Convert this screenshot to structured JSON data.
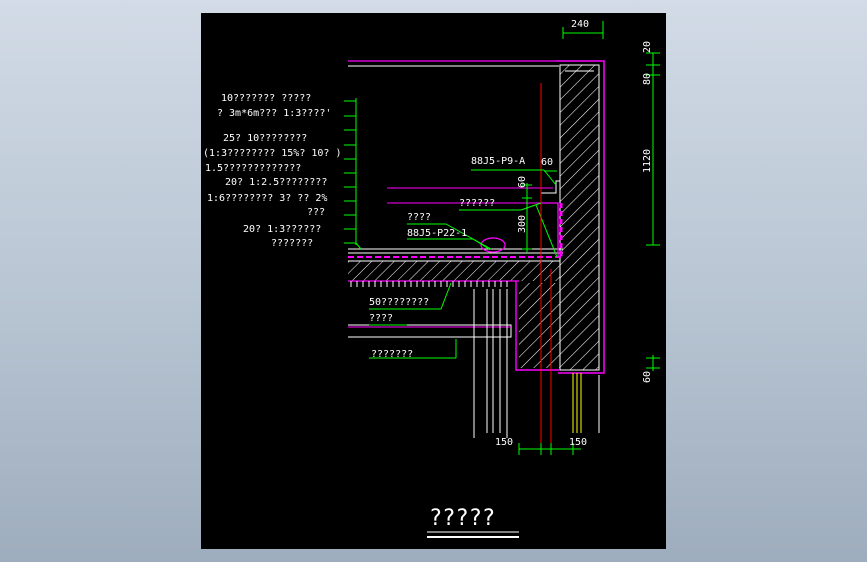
{
  "drawing": {
    "title": "?????",
    "dims": {
      "top_width": "240",
      "right_20": "20",
      "right_80": "80",
      "right_1120": "1120",
      "right_60": "60",
      "inner_60_h": "60",
      "inner_60_v": "60",
      "inner_300": "300",
      "bottom_150_left": "150",
      "bottom_150_right": "150"
    },
    "layer_notes": [
      "10???????  ?????",
      "? 3m*6m???  1:3????'",
      "25? 10????????",
      "(1:3????????  15%? 10? )",
      "1.5?????????????",
      "20? 1:2.5????????",
      "1:6????????   3? ?? 2%",
      "???",
      "20? 1:3??????",
      "???????"
    ],
    "callouts": {
      "ref_top": "88J5-P9-A",
      "ref_mid": "88J5-P22-1",
      "label_a": "??????",
      "label_b": "????",
      "slab_note_1": "50????????",
      "slab_note_2": "????",
      "slab_note_3": "???????"
    },
    "colors": {
      "background": "#000000",
      "wall_outline": "#ff00ff",
      "axis_line": "#ff0000",
      "leader": "#00ff00",
      "dimension": "#00ff00",
      "hatch": "#ffffff"
    }
  }
}
